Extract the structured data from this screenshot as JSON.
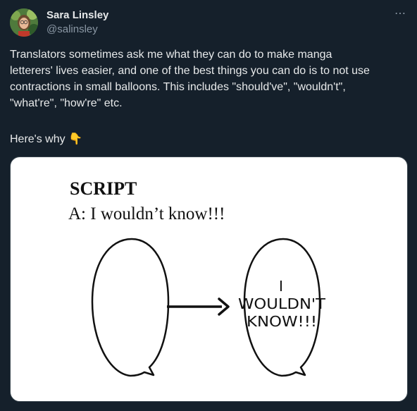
{
  "author": {
    "name": "Sara Linsley",
    "handle": "@salinsley"
  },
  "more_icon": "⋯",
  "tweet": {
    "text_lines": [
      "Translators sometimes ask me what they can do to make manga",
      "letterers' lives easier, and one of the best things you can do is to not use",
      "contractions in small balloons. This includes \"should've\", \"wouldn't\",",
      "\"what're\", \"how're\" etc."
    ],
    "heres_why": "Here's why",
    "emoji": "👇"
  },
  "image": {
    "script_heading": "SCRIPT",
    "script_line": "A: I wouldn’t know!!!",
    "balloon_line1": "I",
    "balloon_line2": "WOULDN'T",
    "balloon_line3": "KNOW!!!"
  }
}
